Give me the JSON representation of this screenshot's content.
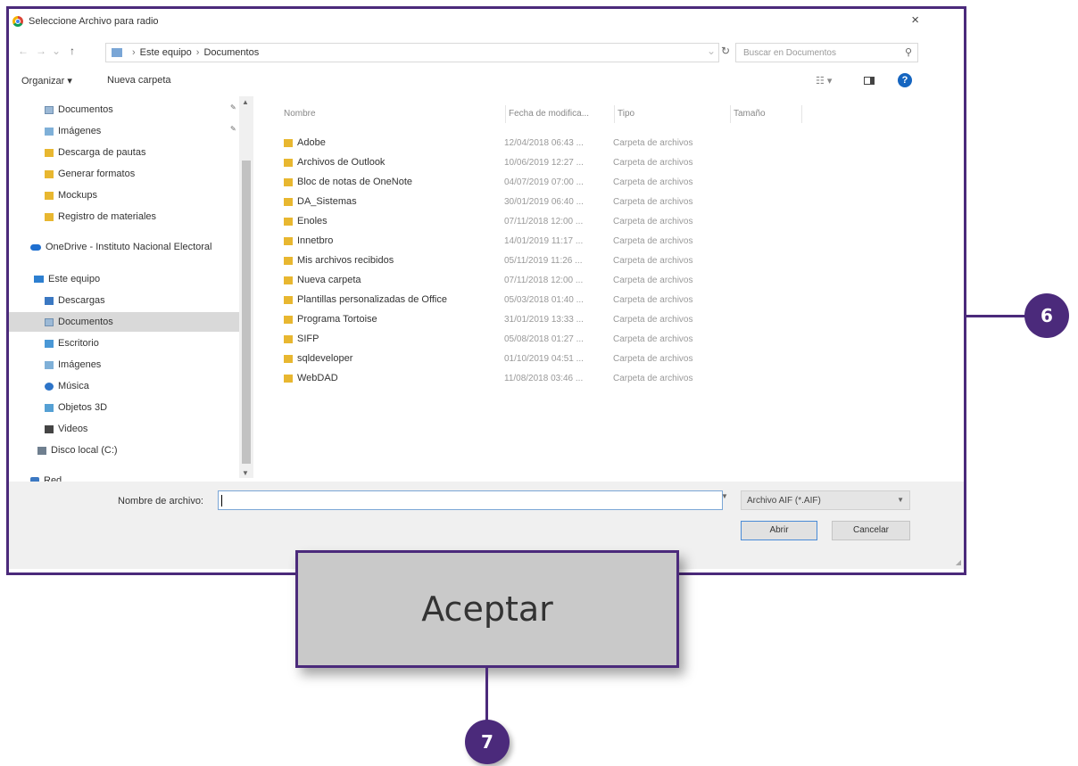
{
  "dialog": {
    "title": "Seleccione Archivo para radio",
    "close_icon": "×",
    "address": {
      "segments": [
        "Este equipo",
        "Documentos"
      ]
    },
    "search_placeholder": "Buscar en Documentos",
    "toolbar": {
      "organize": "Organizar ▾",
      "new_folder": "Nueva carpeta"
    },
    "nav": [
      {
        "label": "Documentos",
        "icon": "doc"
      },
      {
        "label": "Imágenes",
        "icon": "img"
      },
      {
        "label": "Descarga de pautas",
        "icon": "folder"
      },
      {
        "label": "Generar formatos",
        "icon": "folder"
      },
      {
        "label": "Mockups",
        "icon": "folder"
      },
      {
        "label": "Registro de materiales",
        "icon": "folder"
      },
      {
        "label": "OneDrive - Instituto Nacional Electoral",
        "icon": "cloud"
      },
      {
        "label": "Este equipo",
        "icon": "pc"
      },
      {
        "label": "Descargas",
        "icon": "dl"
      },
      {
        "label": "Documentos",
        "icon": "doc"
      },
      {
        "label": "Escritorio",
        "icon": "desk"
      },
      {
        "label": "Imágenes",
        "icon": "img"
      },
      {
        "label": "Música",
        "icon": "music"
      },
      {
        "label": "Objetos 3D",
        "icon": "obj"
      },
      {
        "label": "Videos",
        "icon": "vid"
      },
      {
        "label": "Disco local (C:)",
        "icon": "disk"
      },
      {
        "label": "Red",
        "icon": "net"
      }
    ],
    "columns": [
      "Nombre",
      "Fecha de modifica...",
      "Tipo",
      "Tamaño"
    ],
    "files": [
      {
        "name": "Adobe",
        "date": "12/04/2018 06:43 ...",
        "type": "Carpeta de archivos"
      },
      {
        "name": "Archivos de Outlook",
        "date": "10/06/2019 12:27 ...",
        "type": "Carpeta de archivos"
      },
      {
        "name": "Bloc de notas de OneNote",
        "date": "04/07/2019 07:00 ...",
        "type": "Carpeta de archivos"
      },
      {
        "name": "DA_Sistemas",
        "date": "30/01/2019 06:40 ...",
        "type": "Carpeta de archivos"
      },
      {
        "name": "Enoles",
        "date": "07/11/2018 12:00 ...",
        "type": "Carpeta de archivos"
      },
      {
        "name": "Innetbro",
        "date": "14/01/2019 11:17 ...",
        "type": "Carpeta de archivos"
      },
      {
        "name": "Mis archivos recibidos",
        "date": "05/11/2019 11:26 ...",
        "type": "Carpeta de archivos"
      },
      {
        "name": "Nueva carpeta",
        "date": "07/11/2018 12:00 ...",
        "type": "Carpeta de archivos"
      },
      {
        "name": "Plantillas personalizadas de Office",
        "date": "05/03/2018 01:40 ...",
        "type": "Carpeta de archivos"
      },
      {
        "name": "Programa Tortoise",
        "date": "31/01/2019 13:33 ...",
        "type": "Carpeta de archivos"
      },
      {
        "name": "SIFP",
        "date": "05/08/2018 01:27 ...",
        "type": "Carpeta de archivos"
      },
      {
        "name": "sqldeveloper",
        "date": "01/10/2019 04:51 ...",
        "type": "Carpeta de archivos"
      },
      {
        "name": "WebDAD",
        "date": "11/08/2018 03:46 ...",
        "type": "Carpeta de archivos"
      }
    ],
    "filename_label": "Nombre de archivo:",
    "filename_value": "",
    "filter": "Archivo AIF (*.AIF)",
    "open_button": "Abrir",
    "cancel_button": "Cancelar"
  },
  "overlay": {
    "accept_button": "Aceptar",
    "callout_6": "6",
    "callout_7": "7",
    "accent_color": "#4b2a7b"
  }
}
